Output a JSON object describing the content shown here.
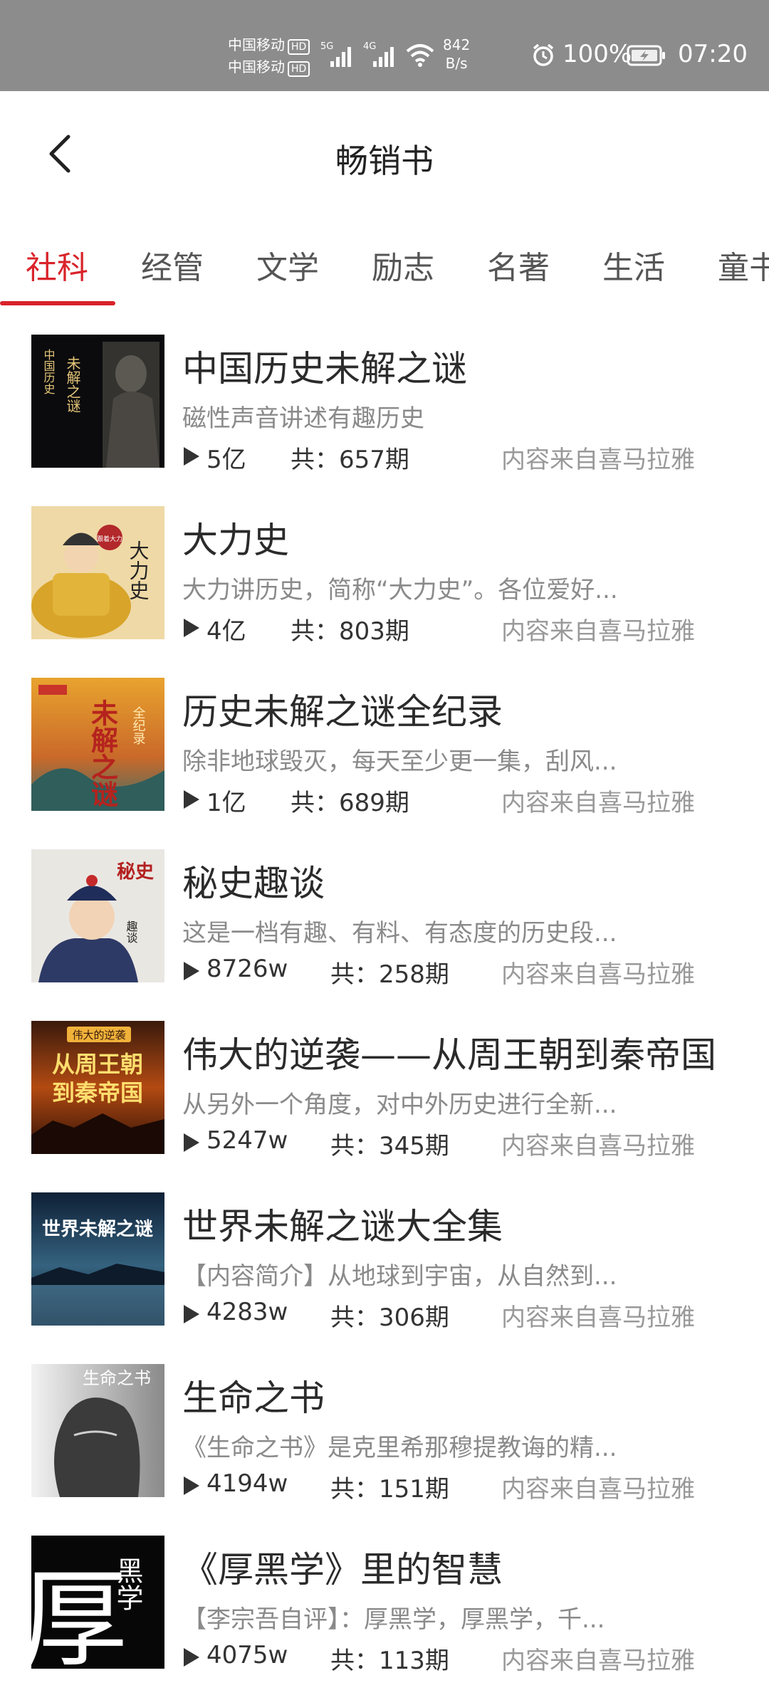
{
  "status_bar": {
    "carrier1": "中国移动",
    "carrier2": "中国移动",
    "hd": "HD",
    "net1": "5G",
    "net2": "4G",
    "speed_value": "842",
    "speed_unit": "B/s",
    "battery": "100%",
    "time": "07:20"
  },
  "header": {
    "title": "畅销书",
    "back_icon": "chevron-left-icon"
  },
  "tabs": [
    {
      "label": "社科",
      "active": true
    },
    {
      "label": "经管",
      "active": false
    },
    {
      "label": "文学",
      "active": false
    },
    {
      "label": "励志",
      "active": false
    },
    {
      "label": "名著",
      "active": false
    },
    {
      "label": "生活",
      "active": false
    },
    {
      "label": "童书",
      "active": false
    }
  ],
  "items": [
    {
      "title": "中国历史未解之谜",
      "desc": "磁性声音讲述有趣历史",
      "plays": "5亿",
      "episodes": "共：657期",
      "source": "内容来自喜马拉雅"
    },
    {
      "title": "大力史",
      "desc": "大力讲历史，简称“大力史”。各位爱好...",
      "plays": "4亿",
      "episodes": "共：803期",
      "source": "内容来自喜马拉雅"
    },
    {
      "title": "历史未解之谜全纪录",
      "desc": "除非地球毁灭，每天至少更一集，刮风...",
      "plays": "1亿",
      "episodes": "共：689期",
      "source": "内容来自喜马拉雅"
    },
    {
      "title": "秘史趣谈",
      "desc": "这是一档有趣、有料、有态度的历史段...",
      "plays": "8726w",
      "episodes": "共：258期",
      "source": "内容来自喜马拉雅"
    },
    {
      "title": "伟大的逆袭——从周王朝到秦帝国",
      "desc": "从另外一个角度，对中外历史进行全新...",
      "plays": "5247w",
      "episodes": "共：345期",
      "source": "内容来自喜马拉雅"
    },
    {
      "title": "世界未解之谜大全集",
      "desc": "【内容简介】从地球到宇宙，从自然到...",
      "plays": "4283w",
      "episodes": "共：306期",
      "source": "内容来自喜马拉雅"
    },
    {
      "title": "生命之书",
      "desc": "《生命之书》是克里希那穆提教诲的精...",
      "plays": "4194w",
      "episodes": "共：151期",
      "source": "内容来自喜马拉雅"
    },
    {
      "title": "《厚黑学》里的智慧",
      "desc": "【李宗吾自评】：厚黑学，厚黑学，千...",
      "plays": "4075w",
      "episodes": "共：113期",
      "source": "内容来自喜马拉雅"
    }
  ],
  "covers": {
    "c1_a": "中国历史",
    "c1_b": "未解之谜",
    "c2_a": "大力史",
    "c2_b": "跟着大力",
    "c3_a": "全纪录",
    "c3_b": "未解之谜",
    "c4_a": "秘史",
    "c4_b": "趣谈",
    "c5_a": "伟大的逆袭",
    "c5_b": "从周王朝",
    "c5_c": "到秦帝国",
    "c6_a": "世界未解之谜",
    "c7_a": "生命之书",
    "c8_a": "厚",
    "c8_b": "黑学"
  },
  "colors": {
    "accent": "#d9232a",
    "status_bar": "#8c8c8c"
  }
}
